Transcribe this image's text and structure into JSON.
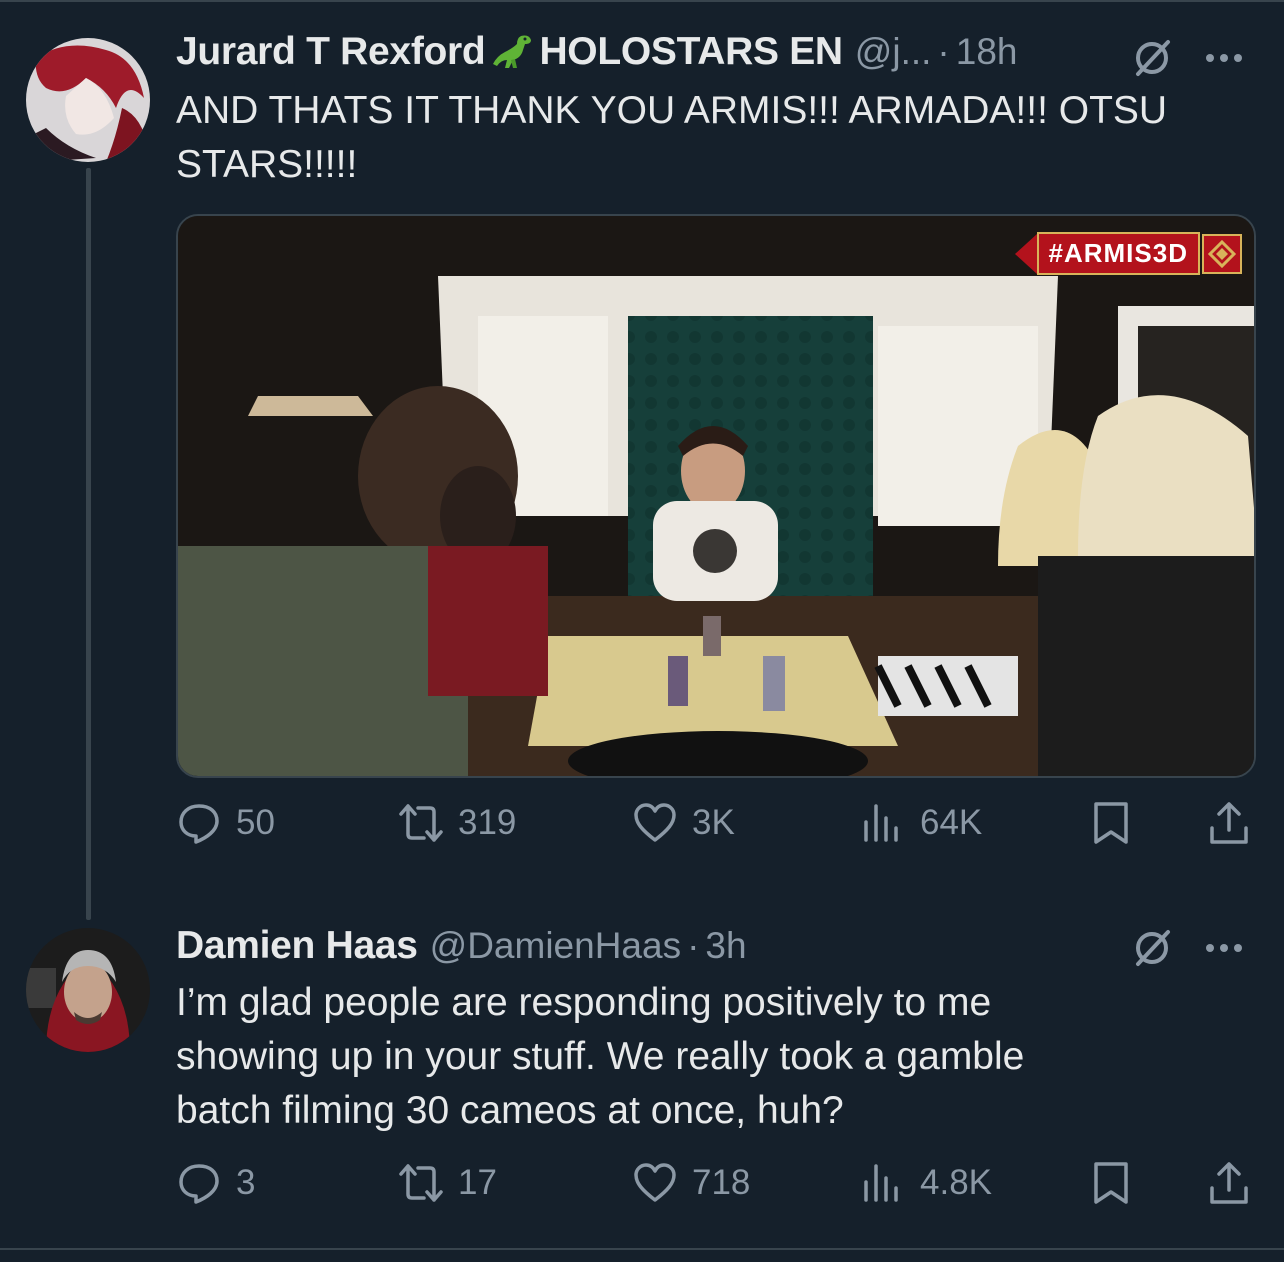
{
  "tweet1": {
    "author_name": "Jurard T Rexford",
    "author_suffix": "HOLOSTARS EN",
    "handle": "@j...",
    "time": "18h",
    "text_line1": "AND THATS IT THANK YOU ARMIS!!! ARMADA!!! OTSU",
    "text_line2": "STARS!!!!!",
    "media_badge": "#ARMIS3D",
    "actions": {
      "replies": "50",
      "reposts": "319",
      "likes": "3K",
      "views": "64K"
    }
  },
  "tweet2": {
    "author_name": "Damien Haas",
    "handle": "@DamienHaas",
    "time": "3h",
    "text_line1": "I’m glad people are responding positively to me",
    "text_line2": "showing up in your stuff. We really took a gamble",
    "text_line3": "batch filming 30 cameos at once, huh?",
    "actions": {
      "replies": "3",
      "reposts": "17",
      "likes": "718",
      "views": "4.8K"
    }
  },
  "separator": "·",
  "colors": {
    "background": "#15202b",
    "secondary_text": "#8b98a5",
    "divider": "#38444d",
    "badge_red": "#b3121c",
    "badge_gold": "#d8b35a"
  }
}
